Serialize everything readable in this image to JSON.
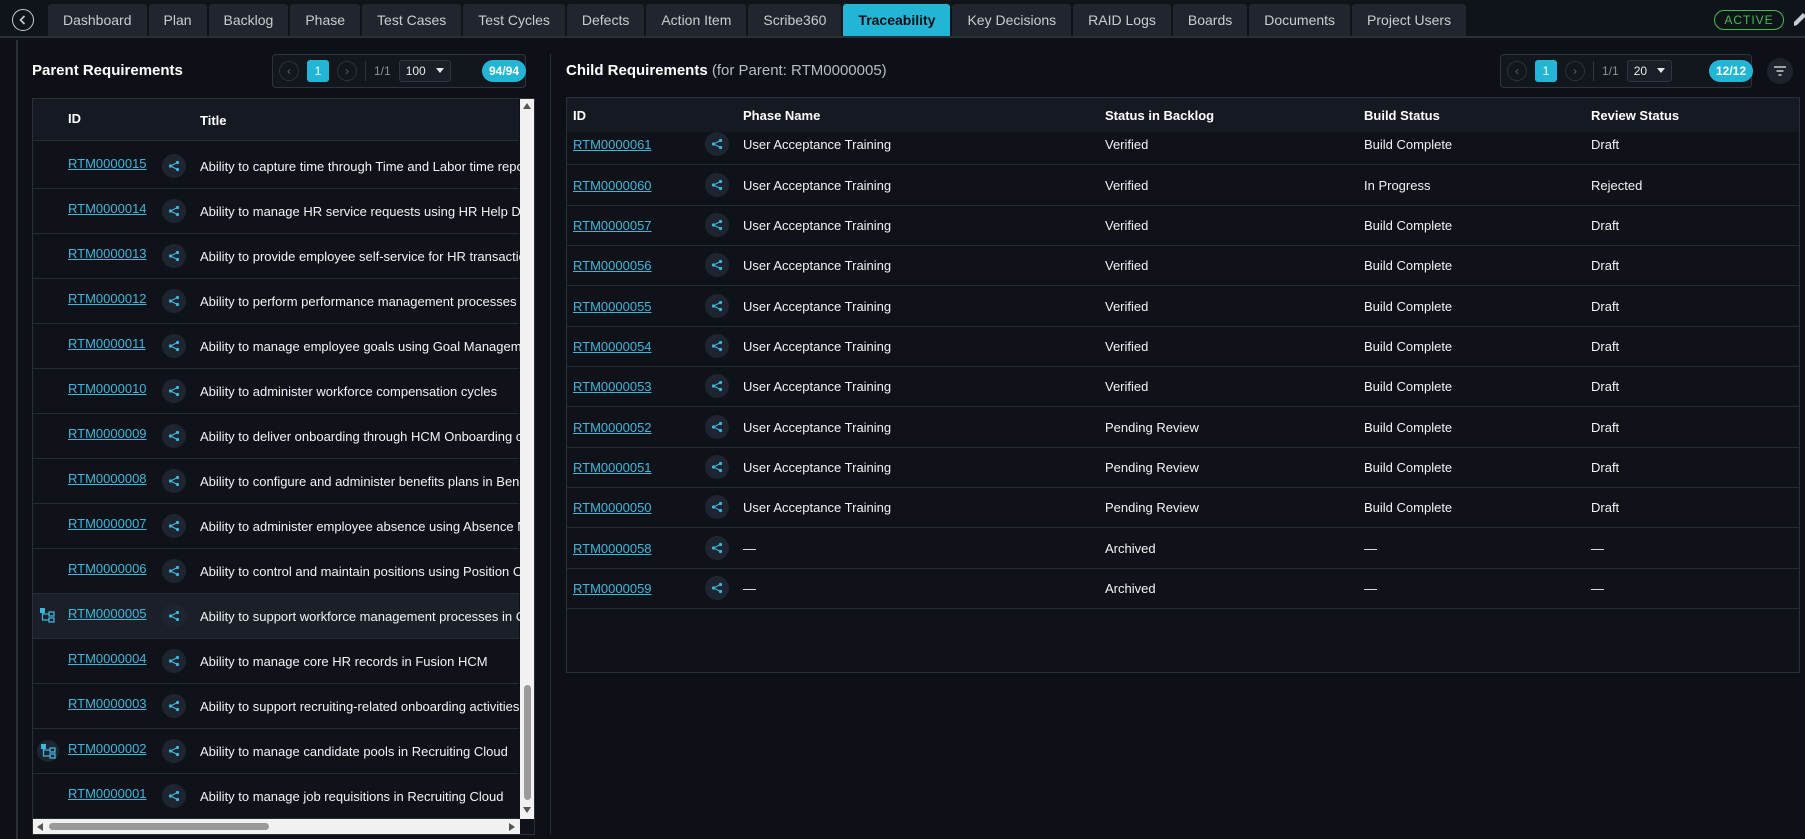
{
  "nav": {
    "tabs": [
      "Dashboard",
      "Plan",
      "Backlog",
      "Phase",
      "Test Cases",
      "Test Cycles",
      "Defects",
      "Action Item",
      "Scribe360",
      "Traceability",
      "Key Decisions",
      "RAID Logs",
      "Boards",
      "Documents",
      "Project Users"
    ],
    "active_tab": "Traceability",
    "status_badge": "ACTIVE"
  },
  "parent_panel": {
    "title": "Parent Requirements",
    "pager": {
      "current_page": "1",
      "page_of": "1/1",
      "page_size": "100",
      "count": "94/94"
    },
    "columns": {
      "id": "ID",
      "title": "Title"
    },
    "rows": [
      {
        "id": "RTM0000015",
        "title": "Ability to capture time through Time and Labor time reporting",
        "tree_icon": ""
      },
      {
        "id": "RTM0000014",
        "title": "Ability to manage HR service requests using HR Help Desk",
        "tree_icon": ""
      },
      {
        "id": "RTM0000013",
        "title": "Ability to provide employee self-service for HR transactions",
        "tree_icon": ""
      },
      {
        "id": "RTM0000012",
        "title": "Ability to perform performance management processes",
        "tree_icon": ""
      },
      {
        "id": "RTM0000011",
        "title": "Ability to manage employee goals using Goal Management",
        "tree_icon": ""
      },
      {
        "id": "RTM0000010",
        "title": "Ability to administer workforce compensation cycles",
        "tree_icon": ""
      },
      {
        "id": "RTM0000009",
        "title": "Ability to deliver onboarding through HCM Onboarding capabilities",
        "tree_icon": ""
      },
      {
        "id": "RTM0000008",
        "title": "Ability to configure and administer benefits plans in Benefits",
        "tree_icon": ""
      },
      {
        "id": "RTM0000007",
        "title": "Ability to administer employee absence using Absence Management",
        "tree_icon": ""
      },
      {
        "id": "RTM0000006",
        "title": "Ability to control and maintain positions using Position Control",
        "tree_icon": ""
      },
      {
        "id": "RTM0000005",
        "title": "Ability to support workforce management processes in Cloud",
        "tree_icon": "plain",
        "selected": true
      },
      {
        "id": "RTM0000004",
        "title": "Ability to manage core HR records in Fusion HCM",
        "tree_icon": ""
      },
      {
        "id": "RTM0000003",
        "title": "Ability to support recruiting-related onboarding activities",
        "tree_icon": ""
      },
      {
        "id": "RTM0000002",
        "title": "Ability to manage candidate pools in Recruiting Cloud",
        "tree_icon": "boxed"
      },
      {
        "id": "RTM0000001",
        "title": "Ability to manage job requisitions in Recruiting Cloud",
        "tree_icon": ""
      }
    ]
  },
  "child_panel": {
    "title": "Child Requirements",
    "subtitle": "(for Parent: RTM0000005)",
    "pager": {
      "current_page": "1",
      "page_of": "1/1",
      "page_size": "20",
      "count": "12/12"
    },
    "columns": {
      "id": "ID",
      "phase": "Phase Name",
      "status": "Status in Backlog",
      "build": "Build Status",
      "review": "Review Status"
    },
    "rows": [
      {
        "id": "RTM0000061",
        "phase": "User Acceptance Training",
        "status": "Verified",
        "build": "Build Complete",
        "review": "Draft"
      },
      {
        "id": "RTM0000060",
        "phase": "User Acceptance Training",
        "status": "Verified",
        "build": "In Progress",
        "review": "Rejected"
      },
      {
        "id": "RTM0000057",
        "phase": "User Acceptance Training",
        "status": "Verified",
        "build": "Build Complete",
        "review": "Draft"
      },
      {
        "id": "RTM0000056",
        "phase": "User Acceptance Training",
        "status": "Verified",
        "build": "Build Complete",
        "review": "Draft"
      },
      {
        "id": "RTM0000055",
        "phase": "User Acceptance Training",
        "status": "Verified",
        "build": "Build Complete",
        "review": "Draft"
      },
      {
        "id": "RTM0000054",
        "phase": "User Acceptance Training",
        "status": "Verified",
        "build": "Build Complete",
        "review": "Draft"
      },
      {
        "id": "RTM0000053",
        "phase": "User Acceptance Training",
        "status": "Verified",
        "build": "Build Complete",
        "review": "Draft"
      },
      {
        "id": "RTM0000052",
        "phase": "User Acceptance Training",
        "status": "Pending Review",
        "build": "Build Complete",
        "review": "Draft"
      },
      {
        "id": "RTM0000051",
        "phase": "User Acceptance Training",
        "status": "Pending Review",
        "build": "Build Complete",
        "review": "Draft"
      },
      {
        "id": "RTM0000050",
        "phase": "User Acceptance Training",
        "status": "Pending Review",
        "build": "Build Complete",
        "review": "Draft"
      },
      {
        "id": "RTM0000058",
        "phase": "—",
        "status": "Archived",
        "build": "—",
        "review": "—"
      },
      {
        "id": "RTM0000059",
        "phase": "—",
        "status": "Archived",
        "build": "—",
        "review": "—"
      }
    ]
  },
  "colors": {
    "accent": "#23b5d6",
    "link": "#3fb6dc",
    "active_green": "#3fbf4a",
    "background": "#0d1117"
  }
}
